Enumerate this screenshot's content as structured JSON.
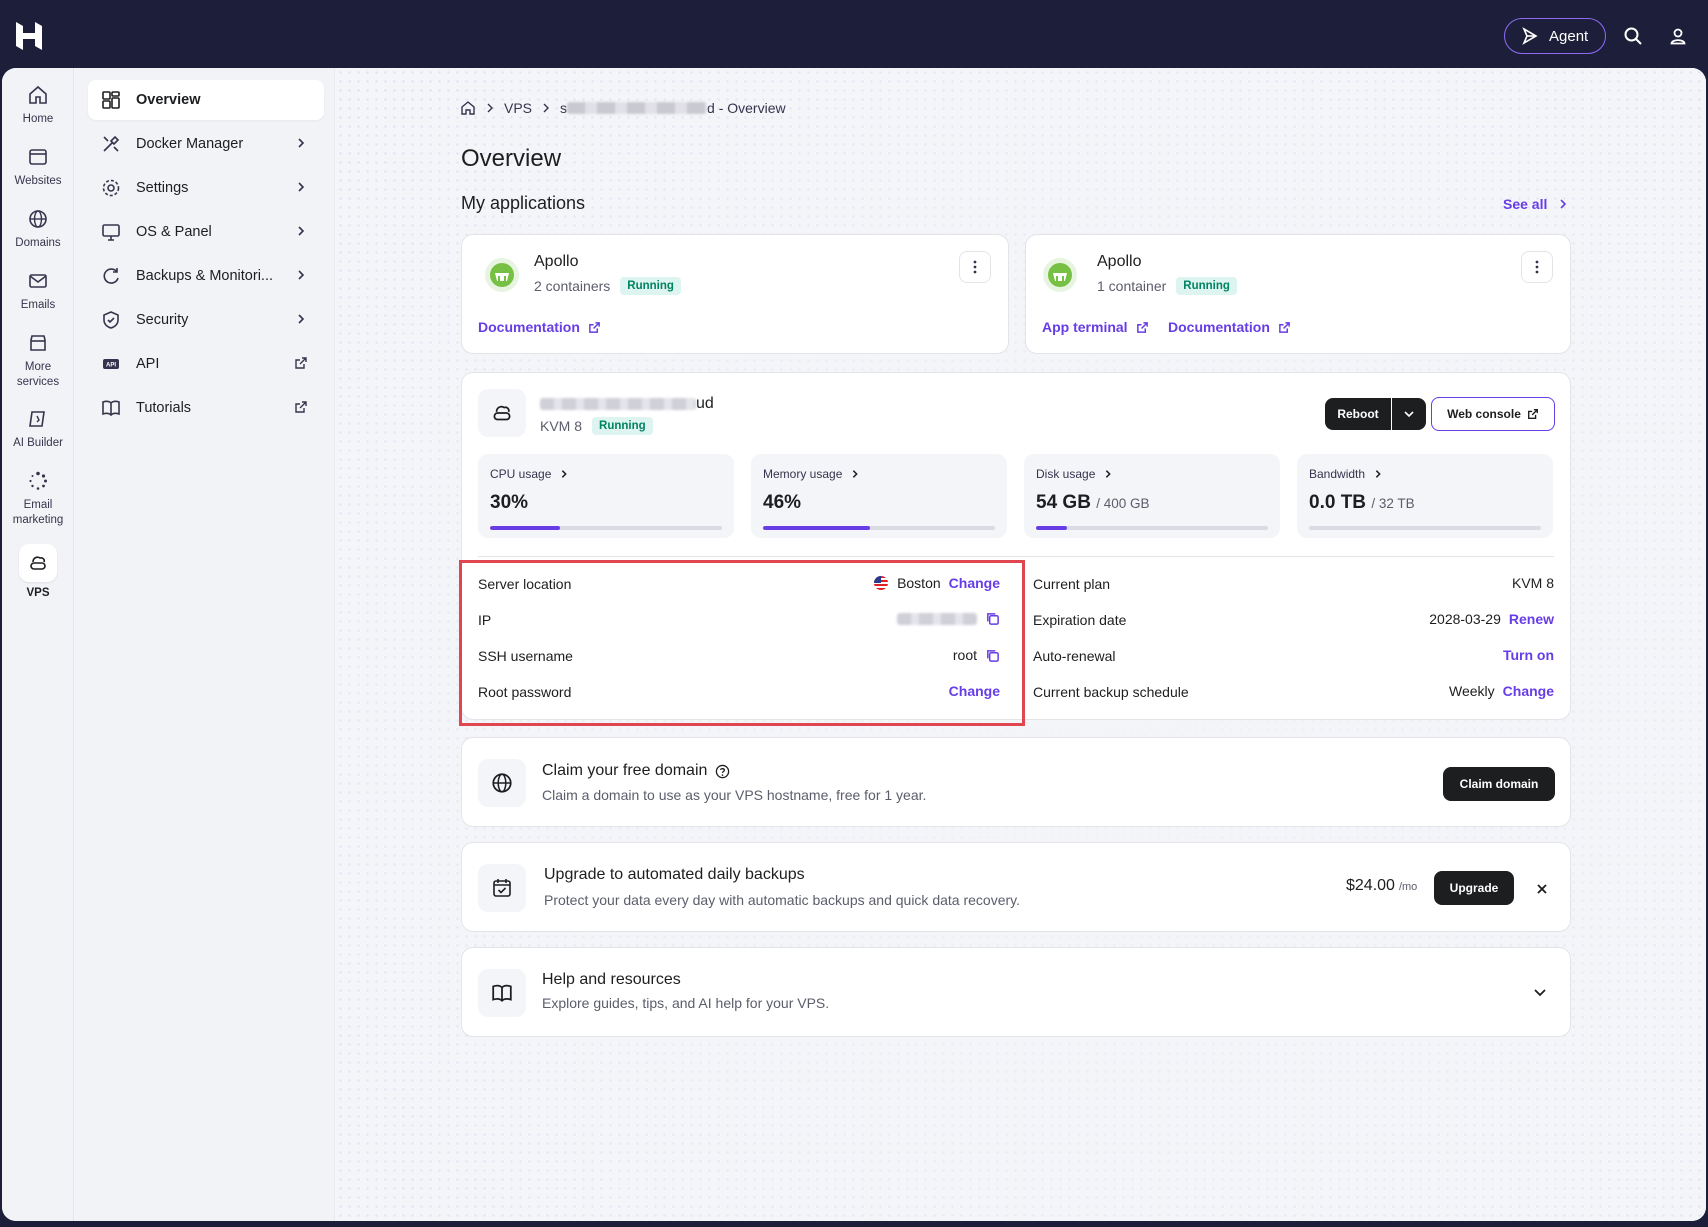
{
  "topbar": {
    "agent_label": "Agent"
  },
  "rail": [
    {
      "label": "Home"
    },
    {
      "label": "Websites"
    },
    {
      "label": "Domains"
    },
    {
      "label": "Emails"
    },
    {
      "label": "More services"
    },
    {
      "label": "AI Builder"
    },
    {
      "label": "Email marketing"
    },
    {
      "label": "VPS"
    }
  ],
  "subnav": [
    {
      "label": "Overview"
    },
    {
      "label": "Docker Manager"
    },
    {
      "label": "Settings"
    },
    {
      "label": "OS & Panel"
    },
    {
      "label": "Backups & Monitori..."
    },
    {
      "label": "Security"
    },
    {
      "label": "API"
    },
    {
      "label": "Tutorials"
    }
  ],
  "breadcrumb": {
    "vps": "VPS",
    "prefix": "s",
    "suffix": "d - Overview"
  },
  "page_title": "Overview",
  "apps": {
    "heading": "My applications",
    "see_all": "See all",
    "items": [
      {
        "name": "Apollo",
        "containers": "2 containers",
        "status": "Running",
        "link1": "Documentation"
      },
      {
        "name": "Apollo",
        "containers": "1 container",
        "status": "Running",
        "link1": "App terminal",
        "link2": "Documentation"
      }
    ]
  },
  "server": {
    "name_suffix": "ud",
    "plan": "KVM 8",
    "status": "Running",
    "reboot": "Reboot",
    "web_console": "Web console",
    "stats": [
      {
        "label": "CPU usage",
        "value": "30%",
        "total": "",
        "fill": 0.3
      },
      {
        "label": "Memory usage",
        "value": "46%",
        "total": "",
        "fill": 0.46
      },
      {
        "label": "Disk usage",
        "value": "54 GB",
        "total": "/ 400 GB",
        "fill": 0.135
      },
      {
        "label": "Bandwidth",
        "value": "0.0 TB",
        "total": "/ 32 TB",
        "fill": 0.0
      }
    ],
    "left_rows": [
      {
        "label": "Server location",
        "value": "Boston",
        "action": "Change"
      },
      {
        "label": "IP",
        "value": "",
        "action": ""
      },
      {
        "label": "SSH username",
        "value": "root",
        "action": ""
      },
      {
        "label": "Root password",
        "value": "",
        "action": "Change"
      }
    ],
    "right_rows": [
      {
        "label": "Current plan",
        "value": "KVM 8",
        "action": ""
      },
      {
        "label": "Expiration date",
        "value": "2028-03-29",
        "action": "Renew"
      },
      {
        "label": "Auto-renewal",
        "value": "",
        "action": "Turn on"
      },
      {
        "label": "Current backup schedule",
        "value": "Weekly",
        "action": "Change"
      }
    ]
  },
  "claim": {
    "title": "Claim your free domain",
    "subtitle": "Claim a domain to use as your VPS hostname, free for 1 year.",
    "button": "Claim domain"
  },
  "backup": {
    "title": "Upgrade to automated daily backups",
    "subtitle": "Protect your data every day with automatic backups and quick data recovery.",
    "price": "$24.00",
    "per": "/mo",
    "button": "Upgrade"
  },
  "help": {
    "title": "Help and resources",
    "subtitle": "Explore guides, tips, and AI help for your VPS."
  },
  "colors": {
    "accent": "#673de6",
    "success": "#008361",
    "topbar": "#1d1e3a",
    "highlight": "#e0464f"
  }
}
